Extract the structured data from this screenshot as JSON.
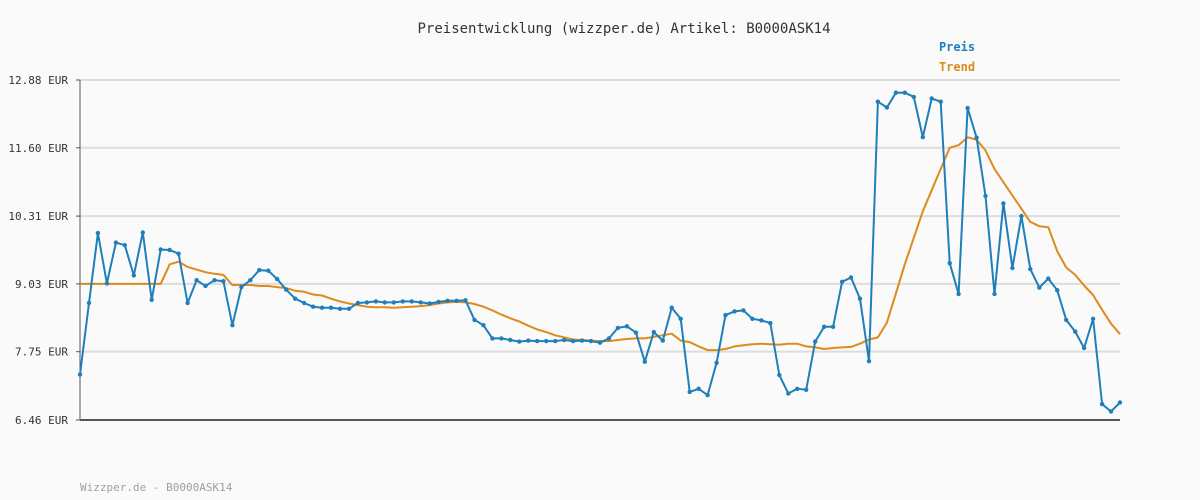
{
  "colors": {
    "price": "#1f7fbb",
    "trend": "#de8a1c",
    "grid": "#dddddd",
    "axis": "#555555",
    "background": "#fafafa"
  },
  "chart_data": {
    "type": "line",
    "title": "Preisentwicklung (wizzper.de) Artikel: B0000ASK14",
    "xlabel": "",
    "ylabel": "",
    "y_unit": "EUR",
    "ylim": [
      6.46,
      12.88
    ],
    "y_ticks": [
      6.46,
      7.75,
      9.03,
      10.31,
      11.6,
      12.88
    ],
    "y_tick_labels": [
      "6.46 EUR",
      "7.75 EUR",
      "9.03 EUR",
      "10.31 EUR",
      "11.60 EUR",
      "12.88 EUR"
    ],
    "grid": true,
    "legend": "top-right",
    "footer": "Wizzper.de - B0000ASK14",
    "series": [
      {
        "name": "Preis",
        "markers": true,
        "values": [
          7.32,
          8.67,
          9.99,
          9.04,
          9.81,
          9.76,
          9.19,
          10.0,
          8.73,
          9.68,
          9.67,
          9.6,
          8.67,
          9.1,
          8.99,
          9.1,
          9.08,
          8.25,
          8.97,
          9.1,
          9.29,
          9.28,
          9.12,
          8.92,
          8.75,
          8.67,
          8.6,
          8.58,
          8.58,
          8.56,
          8.56,
          8.67,
          8.68,
          8.7,
          8.68,
          8.68,
          8.7,
          8.7,
          8.68,
          8.66,
          8.69,
          8.71,
          8.71,
          8.72,
          8.35,
          8.25,
          8.0,
          8.0,
          7.97,
          7.94,
          7.96,
          7.95,
          7.95,
          7.95,
          7.97,
          7.95,
          7.96,
          7.95,
          7.92,
          8.0,
          8.2,
          8.23,
          8.11,
          7.56,
          8.12,
          7.96,
          8.58,
          8.37,
          6.99,
          7.05,
          6.93,
          7.54,
          8.44,
          8.51,
          8.53,
          8.37,
          8.34,
          8.29,
          7.31,
          6.96,
          7.05,
          7.03,
          7.94,
          8.22,
          8.22,
          9.07,
          9.15,
          8.75,
          7.57,
          12.47,
          12.36,
          12.64,
          12.64,
          12.56,
          11.8,
          12.53,
          12.47,
          9.42,
          8.84,
          12.35,
          11.79,
          10.69,
          8.84,
          10.55,
          9.33,
          10.31,
          9.31,
          8.96,
          9.13,
          8.91,
          8.35,
          8.13,
          7.82,
          8.37,
          6.76,
          6.62,
          6.79
        ]
      },
      {
        "name": "Trend",
        "markers": false,
        "values": [
          9.03,
          9.03,
          9.03,
          9.03,
          9.03,
          9.03,
          9.03,
          9.03,
          9.03,
          9.03,
          9.4,
          9.45,
          9.35,
          9.3,
          9.25,
          9.22,
          9.2,
          9.01,
          9.01,
          9.01,
          8.99,
          8.99,
          8.97,
          8.95,
          8.9,
          8.88,
          8.83,
          8.81,
          8.75,
          8.7,
          8.66,
          8.63,
          8.6,
          8.59,
          8.59,
          8.58,
          8.59,
          8.6,
          8.61,
          8.63,
          8.66,
          8.68,
          8.69,
          8.68,
          8.65,
          8.6,
          8.53,
          8.45,
          8.38,
          8.32,
          8.24,
          8.17,
          8.12,
          8.06,
          8.02,
          7.98,
          7.97,
          7.96,
          7.95,
          7.95,
          7.97,
          7.99,
          8.0,
          8.0,
          8.03,
          8.06,
          8.09,
          7.96,
          7.93,
          7.85,
          7.78,
          7.78,
          7.8,
          7.85,
          7.87,
          7.89,
          7.9,
          7.89,
          7.88,
          7.9,
          7.9,
          7.85,
          7.83,
          7.8,
          7.82,
          7.83,
          7.84,
          7.9,
          7.98,
          8.02,
          8.3,
          8.85,
          9.4,
          9.9,
          10.4,
          10.8,
          11.2,
          11.6,
          11.65,
          11.8,
          11.75,
          11.55,
          11.2,
          10.95,
          10.7,
          10.45,
          10.2,
          10.12,
          10.1,
          9.65,
          9.34,
          9.2,
          9.0,
          8.82,
          8.54,
          8.28,
          8.08
        ]
      }
    ]
  }
}
